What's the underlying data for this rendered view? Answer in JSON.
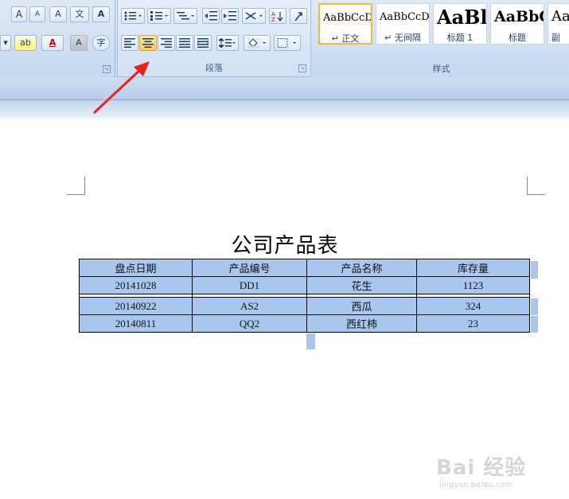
{
  "ribbon": {
    "groups": {
      "paragraph_label": "段落",
      "styles_label": "样式"
    },
    "font_buttons": {
      "grow": "A",
      "shrink": "A",
      "clear": "A",
      "phonetic": "文",
      "border_char": "A",
      "highlight": "ab",
      "font_color": "A",
      "shading": "A",
      "enclose": "字"
    },
    "styles": [
      {
        "sample": "AaBbCcDc",
        "name": "↵ 正文",
        "selected": true
      },
      {
        "sample": "AaBbCcDc",
        "name": "↵ 无间隔",
        "selected": false
      },
      {
        "sample": "AaBl",
        "name": "标题 1",
        "selected": false
      },
      {
        "sample": "AaBbC",
        "name": "标题",
        "selected": false
      },
      {
        "sample": "Aa",
        "name": "副",
        "selected": false
      }
    ]
  },
  "document": {
    "title": "公司产品表",
    "table": {
      "headers": [
        "盘点日期",
        "产品编号",
        "产品名称",
        "库存量"
      ],
      "rows": [
        [
          "20141028",
          "DD1",
          "花生",
          "1123"
        ],
        [
          "20140922",
          "AS2",
          "西瓜",
          "324"
        ],
        [
          "20140811",
          "QQ2",
          "西红柿",
          "23"
        ]
      ]
    }
  },
  "watermark": {
    "logo": "Bai 经验",
    "url": "jingyan.baidu.com"
  },
  "colors": {
    "selection": "#a9c7ee",
    "arrow": "#e8211d",
    "active_button": "#ffc95a"
  }
}
